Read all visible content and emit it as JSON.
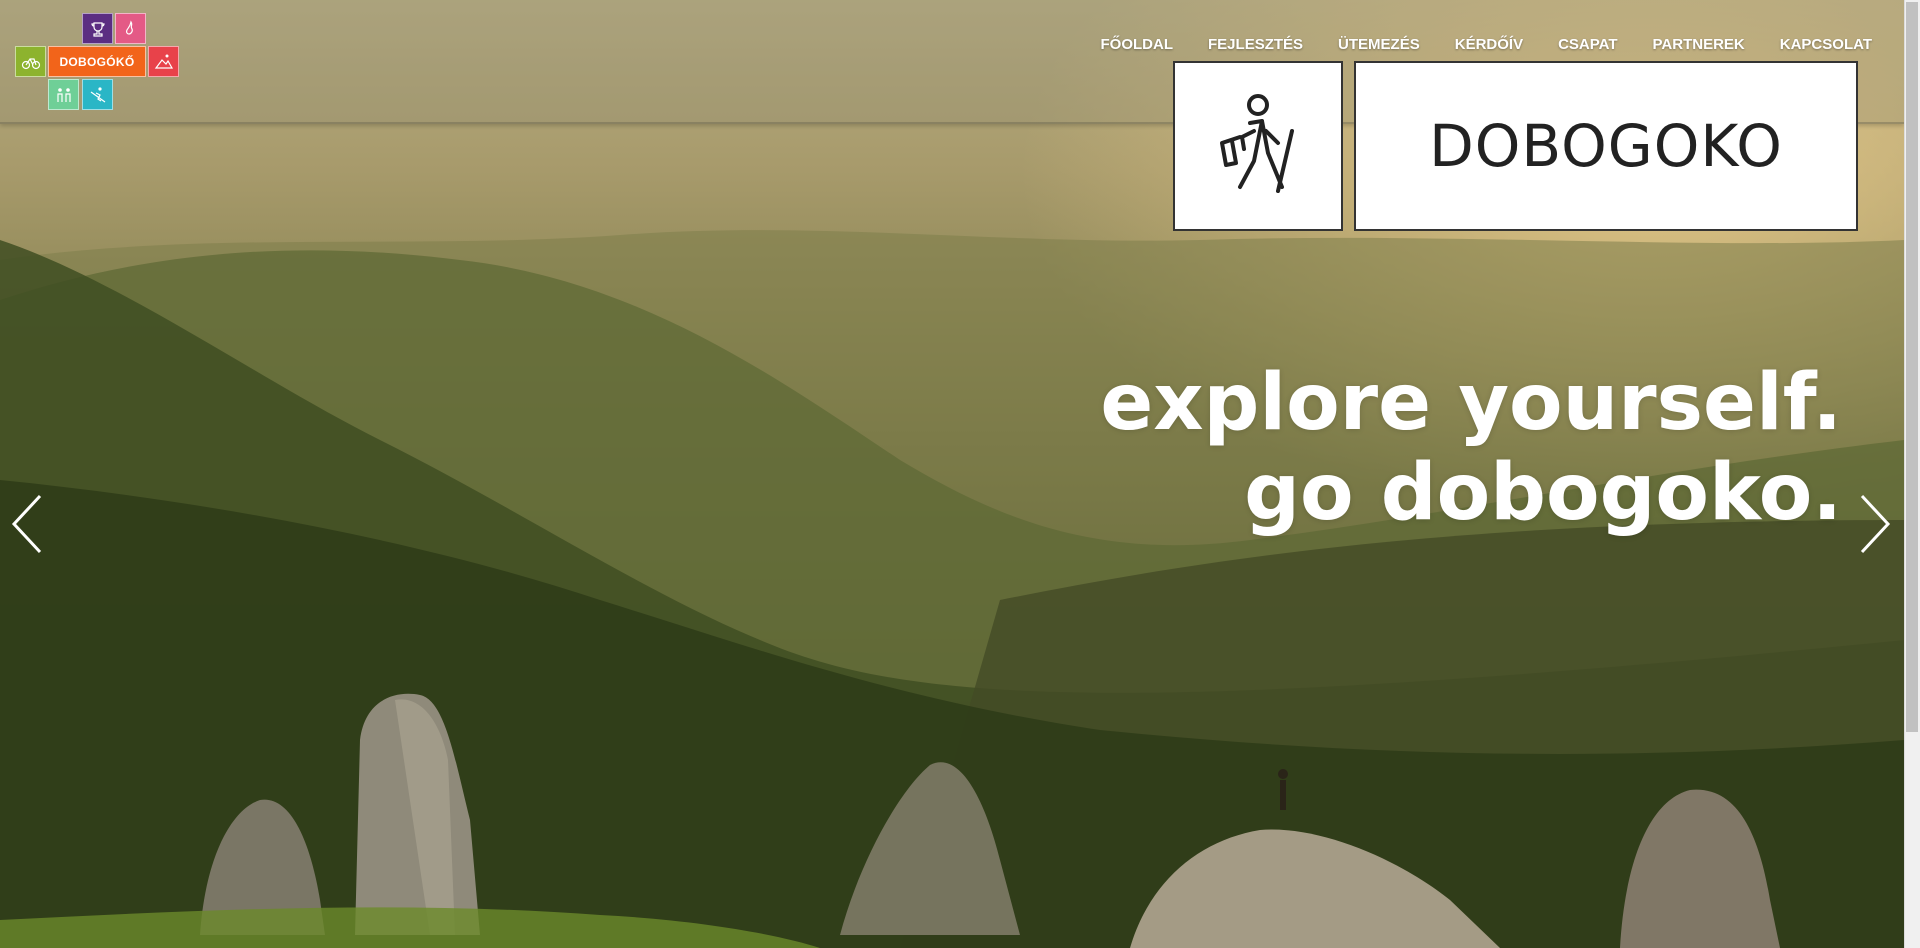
{
  "brand": {
    "tile_label": "DOBOGÓKŐ",
    "logo_text": "DOBOGOKO",
    "icons": [
      "trophy-icon",
      "flame-runner-icon",
      "cyclist-icon",
      "hiking-icon",
      "family-icon",
      "skier-icon"
    ],
    "colors": {
      "purple": "#5b2d82",
      "pink": "#e45a86",
      "lime": "#8db32e",
      "orange": "#f2641a",
      "red": "#e8424a",
      "green": "#6fcf97",
      "cyan": "#2ab6c6"
    }
  },
  "nav": {
    "items": [
      {
        "label": "FŐOLDAL"
      },
      {
        "label": "FEJLESZTÉS"
      },
      {
        "label": "ÜTEMEZÉS"
      },
      {
        "label": "KÉRDŐÍV"
      },
      {
        "label": "CSAPAT"
      },
      {
        "label": "PARTNEREK"
      },
      {
        "label": "KAPCSOLAT"
      }
    ]
  },
  "hero": {
    "tagline_line1": "explore yourself.",
    "tagline_line2": "go dobogoko.",
    "prev_icon": "chevron-left-icon",
    "next_icon": "chevron-right-icon"
  }
}
